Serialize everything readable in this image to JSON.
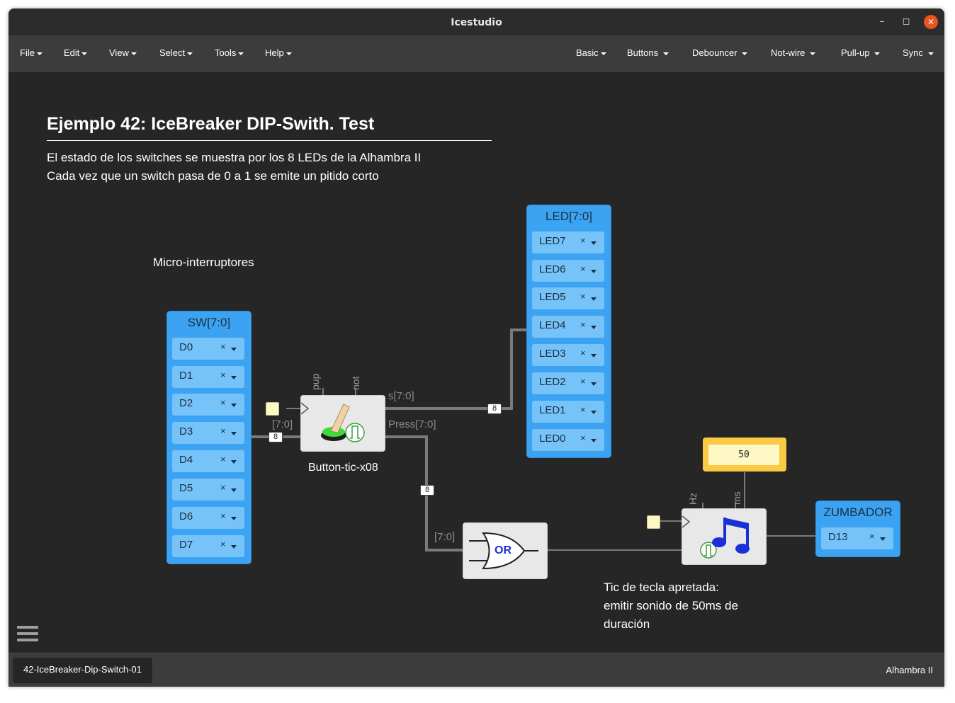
{
  "window": {
    "title": "Icestudio"
  },
  "menus": [
    "File",
    "Edit",
    "View",
    "Select",
    "Tools",
    "Help"
  ],
  "collections": [
    "Basic",
    "Buttons",
    "Debouncer",
    "Not-wire",
    "Pull-up",
    "Sync"
  ],
  "canvas": {
    "title": "Ejemplo 42: IceBreaker DIP-Swith. Test",
    "desc_line1": "El estado de los switches se muestra por los 8 LEDs de la Alhambra II",
    "desc_line2": "Cada vez que un switch pasa de 0 a 1 se emite un pitido corto",
    "switches_label": "Micro-interruptores",
    "sw_block": {
      "title": "SW[7:0]",
      "pins": [
        "D0",
        "D1",
        "D2",
        "D3",
        "D4",
        "D5",
        "D6",
        "D7"
      ]
    },
    "led_block": {
      "title": "LED[7:0]",
      "pins": [
        "LED7",
        "LED6",
        "LED5",
        "LED4",
        "LED3",
        "LED2",
        "LED1",
        "LED0"
      ]
    },
    "buzzer_block": {
      "title": "ZUMBADOR",
      "pin": "D13"
    },
    "button_tic": {
      "name": "Button-tic-x08",
      "param_pup": "pup",
      "param_not": "not",
      "in_port": "[7:0]",
      "out_s": "s[7:0]",
      "out_press": "Press[7:0]"
    },
    "or_gate": {
      "label": "OR",
      "in_port": "[7:0]"
    },
    "tone": {
      "param_hz": "Hz",
      "param_ms": "ms"
    },
    "const_value": "50",
    "bus_width": "8",
    "note": "Tic de tecla apretada:\nemitir sonido de 50ms de\nduración",
    "note_lines": [
      "Tic de tecla apretada:",
      "emitir sonido de 50ms de",
      "duración"
    ],
    "pin_remove_symbol": "×"
  },
  "status": {
    "file": "42-IceBreaker-Dip-Switch-01",
    "board": "Alhambra II"
  },
  "icons": {
    "menu": "hamburger-icon",
    "close": "close-icon",
    "maximize": "maximize-icon",
    "minimize": "minimize-icon"
  },
  "colors": {
    "pin_block": "#3ba3f2",
    "pin_slot": "#76c3fa",
    "const_block": "#fcc944",
    "close_button": "#e95420"
  }
}
